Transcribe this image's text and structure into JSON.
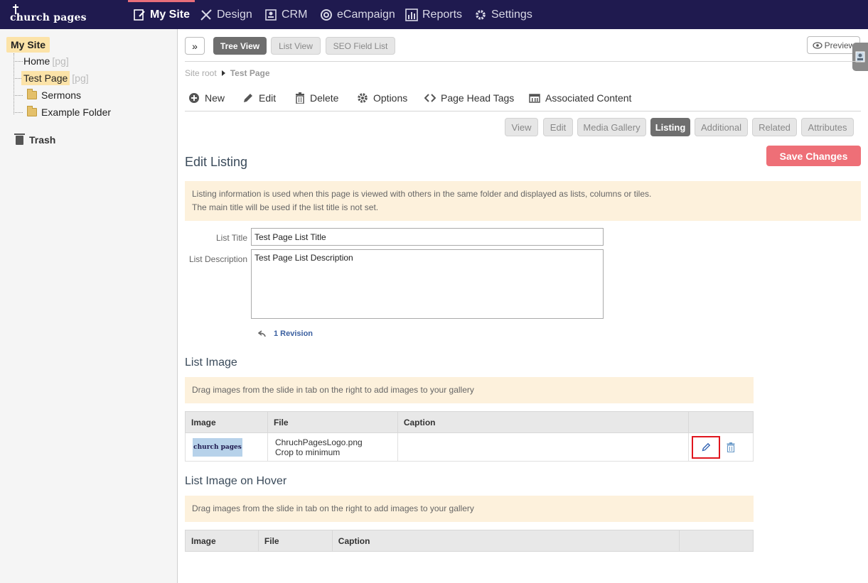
{
  "brand": {
    "logo_text": "church pages"
  },
  "nav": {
    "my_site": "My Site",
    "design": "Design",
    "crm": "CRM",
    "ecampaign": "eCampaign",
    "reports": "Reports",
    "settings": "Settings"
  },
  "sidebar": {
    "root": "My Site",
    "items": [
      {
        "label": "Home",
        "tag": "[pg]"
      },
      {
        "label": "Test Page",
        "tag": "[pg]"
      },
      {
        "label": "Sermons"
      },
      {
        "label": "Example Folder"
      }
    ],
    "trash": "Trash"
  },
  "viewbar": {
    "tree_view": "Tree View",
    "list_view": "List View",
    "seo": "SEO Field List",
    "preview": "Preview"
  },
  "breadcrumb": {
    "root": "Site root",
    "current": "Test Page"
  },
  "toolbar": {
    "new": "New",
    "edit": "Edit",
    "delete": "Delete",
    "options": "Options",
    "head_tags": "Page Head Tags",
    "associated": "Associated Content"
  },
  "tabs": [
    "View",
    "Edit",
    "Media Gallery",
    "Listing",
    "Additional",
    "Related",
    "Attributes"
  ],
  "save_label": "Save Changes",
  "edit_listing": {
    "heading": "Edit Listing",
    "info_line1": "Listing information is used when this page is viewed with others in the same folder and displayed as lists, columns or tiles.",
    "info_line2": "The main title will be used if the list title is not set.",
    "title_label": "List Title",
    "title_value": "Test Page List Title",
    "desc_label": "List Description",
    "desc_value": "Test Page List Description",
    "revision": "1 Revision"
  },
  "list_image": {
    "heading": "List Image",
    "info": "Drag images from the slide in tab on the right to add images to your gallery",
    "cols": [
      "Image",
      "File",
      "Caption"
    ],
    "row": {
      "thumb_text": "church pages",
      "file": "ChruchPagesLogo.png",
      "crop": "Crop to minimum",
      "caption": ""
    }
  },
  "hover_image": {
    "heading": "List Image on Hover",
    "info": "Drag images from the slide in tab on the right to add images to your gallery",
    "cols": [
      "Image",
      "File",
      "Caption"
    ]
  }
}
